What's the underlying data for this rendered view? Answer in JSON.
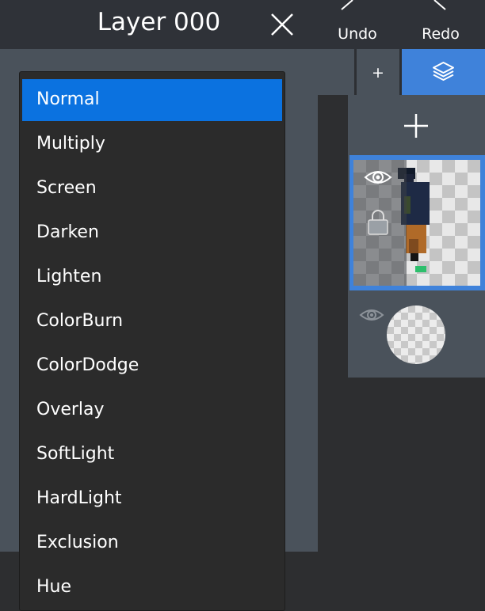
{
  "panel": {
    "title": "Layer 000"
  },
  "toolbar": {
    "undo_label": "Undo",
    "redo_label": "Redo",
    "add_label": "+"
  },
  "blend_modes": [
    "Normal",
    "Multiply",
    "Screen",
    "Darken",
    "Lighten",
    "ColorBurn",
    "ColorDodge",
    "Overlay",
    "SoftLight",
    "HardLight",
    "Exclusion",
    "Hue"
  ],
  "selected_blend_mode": "Normal",
  "icons": [
    "close-icon",
    "undo-icon",
    "redo-icon",
    "layers-icon",
    "plus-icon",
    "eye-icon",
    "lock-icon"
  ],
  "colors": {
    "accent": "#3f82da",
    "selection": "#0b72e0",
    "panel": "#4a525b",
    "header": "#2f3238",
    "dropdown": "#2b2b2b"
  }
}
